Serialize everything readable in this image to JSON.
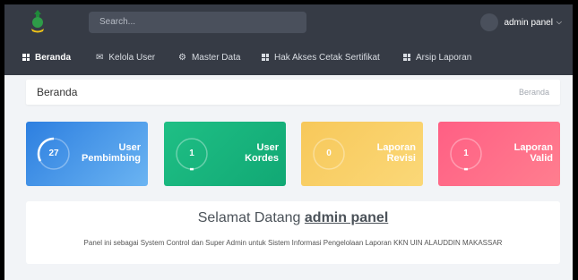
{
  "search": {
    "placeholder": "Search..."
  },
  "user": {
    "name": "admin panel"
  },
  "nav": [
    {
      "label": "Beranda"
    },
    {
      "label": "Kelola User"
    },
    {
      "label": "Master Data"
    },
    {
      "label": "Hak Akses Cetak Sertifikat"
    },
    {
      "label": "Arsip Laporan"
    }
  ],
  "breadcrumb": {
    "title": "Beranda",
    "current": "Beranda"
  },
  "cards": [
    {
      "value": "27",
      "label1": "User",
      "label2": "Pembimbing"
    },
    {
      "value": "1",
      "label1": "User",
      "label2": "Kordes"
    },
    {
      "value": "0",
      "label1": "Laporan",
      "label2": "Revisi"
    },
    {
      "value": "1",
      "label1": "Laporan",
      "label2": "Valid"
    }
  ],
  "welcome": {
    "title_prefix": "Selamat Datang",
    "title_user": "admin panel",
    "description": "Panel ini sebagai System Control dan Super Admin untuk Sistem Informasi Pengelolaan Laporan KKN UIN ALAUDDIN MAKASSAR"
  },
  "colors": {
    "header": "#363b45",
    "card_blue": "#3a8fe8",
    "card_green": "#1ab57b",
    "card_yellow": "#f8cf66",
    "card_pink": "#ff6b88"
  }
}
